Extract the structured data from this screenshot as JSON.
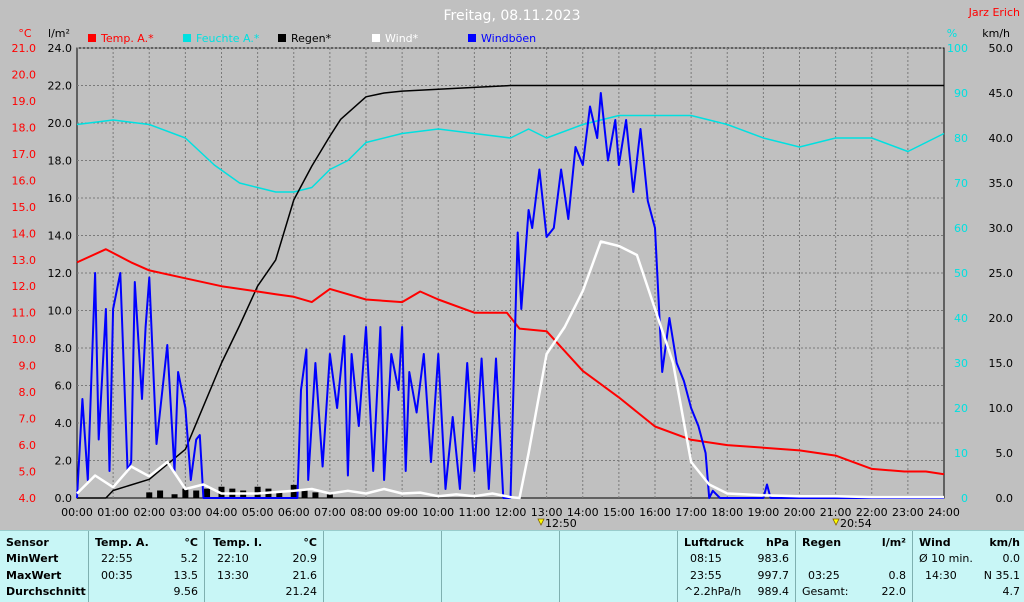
{
  "header": {
    "title": "Freitag, 08.11.2023",
    "station": "Jarz Erich"
  },
  "axes": {
    "unit_temp": "°C",
    "unit_rain": "l/m²",
    "unit_pct": "%",
    "unit_wind": "km/h"
  },
  "sun_markers": {
    "sunrise": "12:50",
    "sunset": "20:54"
  },
  "colors": {
    "temp": "#ff0000",
    "humidity": "#00e0e0",
    "rain": "#000000",
    "wind": "#ffffff",
    "gust": "#0000ff",
    "background": "#c0c0c0",
    "table": "#c8f6f6"
  },
  "chart_data": {
    "type": "line",
    "title": "Freitag, 08.11.2023",
    "x_tick_labels": [
      "00:00",
      "01:00",
      "02:00",
      "03:00",
      "04:00",
      "05:00",
      "06:00",
      "07:00",
      "08:00",
      "09:00",
      "10:00",
      "11:00",
      "12:00",
      "13:00",
      "14:00",
      "15:00",
      "16:00",
      "17:00",
      "18:00",
      "19:00",
      "20:00",
      "21:00",
      "22:00",
      "23:00",
      "24:00"
    ],
    "y_temp": {
      "label": "°C",
      "range": [
        4.0,
        21.0
      ],
      "ticks": [
        "4.0",
        "5.0",
        "6.0",
        "7.0",
        "8.0",
        "9.0",
        "10.0",
        "11.0",
        "12.0",
        "13.0",
        "14.0",
        "15.0",
        "16.0",
        "17.0",
        "18.0",
        "19.0",
        "20.0",
        "21.0"
      ]
    },
    "y_rain": {
      "label": "l/m²",
      "range": [
        0.0,
        24.0
      ],
      "ticks": [
        "0.0",
        "2.0",
        "4.0",
        "6.0",
        "8.0",
        "10.0",
        "12.0",
        "14.0",
        "16.0",
        "18.0",
        "20.0",
        "22.0",
        "24.0"
      ]
    },
    "y_humidity": {
      "label": "%",
      "range": [
        0,
        100
      ],
      "ticks": [
        "0",
        "10",
        "20",
        "30",
        "40",
        "50",
        "60",
        "70",
        "80",
        "90",
        "100"
      ]
    },
    "y_wind": {
      "label": "km/h",
      "range": [
        0.0,
        50.0
      ],
      "ticks": [
        "0.0",
        "5.0",
        "10.0",
        "15.0",
        "20.0",
        "25.0",
        "30.0",
        "35.0",
        "40.0",
        "45.0",
        "50.0"
      ]
    },
    "legend": [
      "Temp. A.*",
      "Feuchte A.*",
      "Regen*",
      "Wind*",
      "Windböen"
    ],
    "series": [
      {
        "name": "Temp. A.*",
        "axis": "temp",
        "x": [
          0,
          0.8,
          1.5,
          2,
          3,
          4,
          5,
          5.5,
          6,
          6.5,
          7,
          8,
          9,
          9.5,
          10,
          11,
          11.9,
          12.25,
          13,
          14,
          15,
          16,
          17,
          18,
          19,
          20,
          21,
          22,
          22.9,
          23.5,
          24
        ],
        "values": [
          12.9,
          13.4,
          12.9,
          12.6,
          12.3,
          12.0,
          11.8,
          11.7,
          11.6,
          11.4,
          11.9,
          11.5,
          11.4,
          11.8,
          11.5,
          11.0,
          11.0,
          10.4,
          10.3,
          8.8,
          7.8,
          6.7,
          6.2,
          6.0,
          5.9,
          5.8,
          5.6,
          5.1,
          5.0,
          5.0,
          4.9
        ]
      },
      {
        "name": "Feuchte A.*",
        "axis": "humidity",
        "x": [
          0,
          1,
          2,
          3,
          3.8,
          4.5,
          5,
          5.5,
          6,
          6.5,
          7,
          7.5,
          8,
          9,
          10,
          11,
          12,
          12.5,
          13,
          14,
          15,
          16,
          17,
          18,
          19,
          20,
          21,
          22,
          23,
          24
        ],
        "values": [
          83,
          84,
          83,
          80,
          74,
          70,
          69,
          68,
          68,
          69,
          73,
          75,
          79,
          81,
          82,
          81,
          80,
          82,
          80,
          83,
          85,
          85,
          85,
          83,
          80,
          78,
          80,
          80,
          77,
          81
        ]
      },
      {
        "name": "Regen*",
        "axis": "rain",
        "x": [
          0,
          0.8,
          1,
          2,
          3,
          4,
          4.5,
          5,
          5.5,
          6,
          6.5,
          7,
          7.3,
          8,
          8.5,
          9,
          10,
          11,
          12,
          13,
          14,
          15,
          16,
          16.5,
          17,
          24
        ],
        "values": [
          0.0,
          0.0,
          0.4,
          1.0,
          2.6,
          7.2,
          9.2,
          11.3,
          12.7,
          15.9,
          17.7,
          19.3,
          20.2,
          21.4,
          21.6,
          21.7,
          21.8,
          21.9,
          22.0,
          22.0,
          22.0,
          22.0,
          22.0,
          22.0,
          22.0,
          22.0
        ]
      },
      {
        "name": "Wind*",
        "axis": "wind",
        "x": [
          0,
          0.5,
          1,
          1.5,
          2,
          2.5,
          3,
          3.5,
          4,
          5,
          6,
          6.5,
          7,
          7.5,
          8,
          8.5,
          9,
          9.5,
          10,
          10.5,
          11,
          11.5,
          12,
          12.25,
          12.5,
          13,
          13.5,
          14,
          14.5,
          15,
          15.5,
          16,
          16.5,
          17,
          17.5,
          18,
          19,
          20,
          21,
          22,
          23,
          24
        ],
        "values": [
          0.5,
          2.5,
          1.2,
          3.5,
          2.4,
          4.0,
          1.0,
          1.5,
          0.5,
          0.5,
          0.8,
          1.0,
          0.5,
          0.8,
          0.5,
          1.0,
          0.5,
          0.6,
          0.2,
          0.4,
          0.2,
          0.5,
          0.1,
          0.0,
          5.0,
          16.0,
          19.0,
          23.0,
          28.5,
          28.0,
          27.0,
          21.0,
          15.0,
          4.0,
          1.5,
          0.5,
          0.3,
          0.2,
          0.2,
          0.1,
          0.1,
          0.1
        ]
      },
      {
        "name": "Windböen",
        "axis": "wind",
        "x": [
          0,
          0.15,
          0.3,
          0.5,
          0.6,
          0.8,
          0.9,
          1,
          1.2,
          1.4,
          1.5,
          1.6,
          1.8,
          1.9,
          2,
          2.2,
          2.5,
          2.7,
          2.8,
          3,
          3.15,
          3.3,
          3.4,
          3.5,
          6.1,
          6.2,
          6.35,
          6.4,
          6.6,
          6.8,
          7,
          7.2,
          7.4,
          7.5,
          7.6,
          7.8,
          8,
          8.2,
          8.4,
          8.5,
          8.7,
          8.9,
          9,
          9.1,
          9.2,
          9.4,
          9.6,
          9.8,
          10,
          10.2,
          10.4,
          10.6,
          10.8,
          11,
          11.2,
          11.4,
          11.6,
          11.8,
          12,
          12.2,
          12.3,
          12.5,
          12.6,
          12.8,
          13,
          13.2,
          13.4,
          13.6,
          13.8,
          14,
          14.2,
          14.4,
          14.5,
          14.7,
          14.9,
          15,
          15.2,
          15.4,
          15.6,
          15.8,
          16,
          16.2,
          16.4,
          16.6,
          16.8,
          17,
          17.2,
          17.4,
          17.5,
          17.6,
          17.8,
          18,
          19,
          19.1,
          19.2,
          19.3,
          20,
          24
        ],
        "values": [
          0.0,
          11.0,
          2.0,
          25.0,
          6.5,
          21.0,
          3.0,
          21.0,
          25.0,
          3.0,
          4.0,
          24.0,
          11.0,
          19.0,
          24.5,
          6.0,
          17.0,
          3.0,
          14.0,
          10.0,
          2.0,
          6.5,
          7.0,
          0.0,
          0.0,
          12.0,
          16.5,
          2.0,
          15.0,
          3.5,
          16.0,
          10.0,
          18.0,
          2.5,
          16.0,
          8.0,
          19.0,
          3.0,
          19.0,
          2.0,
          16.0,
          12.0,
          19.0,
          3.0,
          14.0,
          9.5,
          16.0,
          4.0,
          16.0,
          1.0,
          9.0,
          1.0,
          15.0,
          3.0,
          15.5,
          1.0,
          15.5,
          0.0,
          0.0,
          29.5,
          21.0,
          32.0,
          30.0,
          36.5,
          29.0,
          30.0,
          36.5,
          31.0,
          39.0,
          37.0,
          43.5,
          40.0,
          45.0,
          37.5,
          42.0,
          37.0,
          42.0,
          34.0,
          41.0,
          33.0,
          30.0,
          14.0,
          20.0,
          15.0,
          13.0,
          10.0,
          8.0,
          5.0,
          0.0,
          0.8,
          0.0,
          0.0,
          0.0,
          1.5,
          0.0,
          0.0,
          0.0,
          0.0
        ]
      }
    ],
    "rain_ticks": {
      "x": [
        2.0,
        2.3,
        2.7,
        3.0,
        3.3,
        3.6,
        4.0,
        4.3,
        4.6,
        5.0,
        5.3,
        5.6,
        6.0,
        6.3,
        6.6,
        7.0
      ],
      "values": [
        0.3,
        0.4,
        0.2,
        0.5,
        0.4,
        0.5,
        0.6,
        0.5,
        0.4,
        0.6,
        0.5,
        0.3,
        0.7,
        0.4,
        0.3,
        0.2
      ]
    }
  },
  "table": {
    "sensor": {
      "header": "Sensor",
      "min": "MinWert",
      "max": "MaxWert",
      "avg": "Durchschnitt"
    },
    "temp_a": {
      "header": "Temp. A.",
      "unit": "°C",
      "min_time": "22:55",
      "min_val": "5.2",
      "max_time": "00:35",
      "max_val": "13.5",
      "avg": "9.56"
    },
    "temp_i": {
      "header": "Temp. I.",
      "unit": "°C",
      "min_time": "22:10",
      "min_val": "20.9",
      "max_time": "13:30",
      "max_val": "21.6",
      "avg": "21.24"
    },
    "pressure": {
      "header": "Luftdruck",
      "unit": "hPa",
      "min_time": "08:15",
      "min_val": "983.6",
      "max_time": "23:55",
      "max_val": "997.7",
      "trend_label": "^2.2hPa/h",
      "trend_val": "989.4"
    },
    "rain": {
      "header": "Regen",
      "unit": "l/m²",
      "max_time": "03:25",
      "max_val": "0.8",
      "total_label": "Gesamt:",
      "total_val": "22.0"
    },
    "wind": {
      "header": "Wind",
      "unit": "km/h",
      "min_label": "Ø 10 min.",
      "min_val": "0.0",
      "max_time": "14:30",
      "max_val": "N 35.1",
      "avg": "4.7"
    }
  }
}
